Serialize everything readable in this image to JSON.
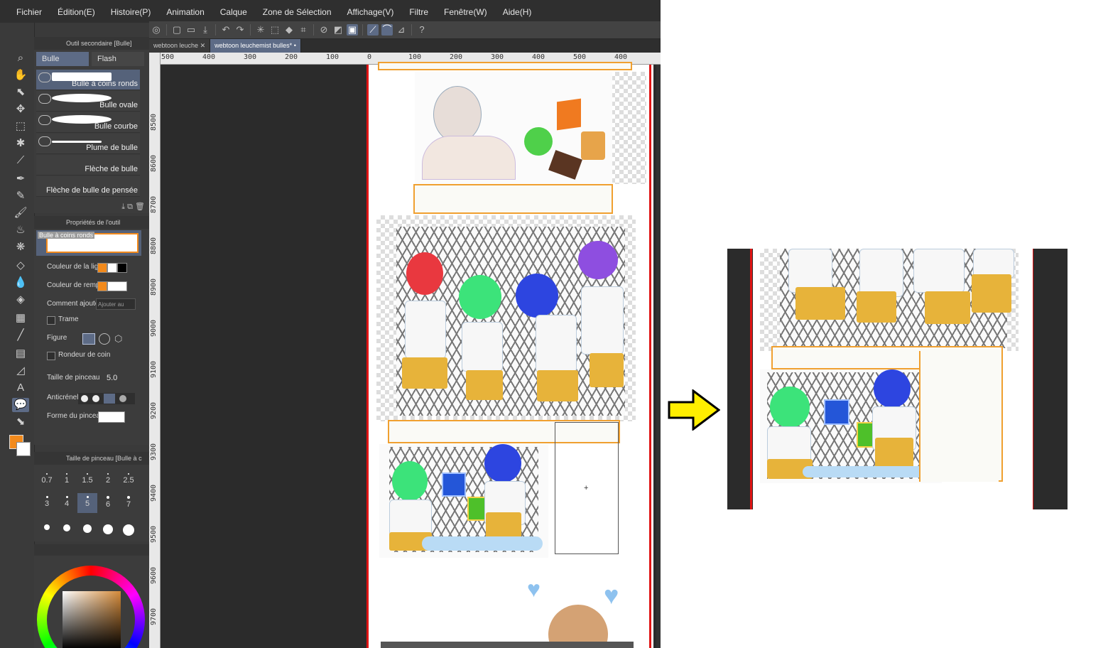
{
  "menu": [
    "Fichier",
    "Édition(E)",
    "Histoire(P)",
    "Animation",
    "Calque",
    "Zone de Sélection",
    "Affichage(V)",
    "Filtre",
    "Fenêtre(W)",
    "Aide(H)"
  ],
  "subtool": {
    "title": "Outil secondaire [Bulle]",
    "tabs": [
      "Bulle",
      "Flash"
    ],
    "items": [
      "Bulle à coins ronds",
      "Bulle ovale",
      "Bulle courbe",
      "Plume de bulle",
      "Flèche de bulle",
      "Flèche de bulle de pensée"
    ]
  },
  "tool_props": {
    "title": "Propriétés de l'outil",
    "preview_label": "Bulle à coins ronds",
    "line_color_label": "Couleur de la ligne",
    "fill_color_label": "Couleur de remplis",
    "add_mode_label": "Comment ajouter",
    "add_mode_value": "Ajouter au",
    "screentone_label": "Trame",
    "figure_label": "Figure",
    "corner_label": "Rondeur de coin",
    "brush_size_label": "Taille de pinceau",
    "brush_size_value": "5.0",
    "antialias_label": "Anticrénel.",
    "brush_shape_label": "Forme du pinceau"
  },
  "brush_size_panel": {
    "title": "Taille de pinceau [Bulle à c",
    "row1": [
      "0.7",
      "1",
      "1.5",
      "2",
      "2.5"
    ],
    "row2": [
      "3",
      "4",
      "5",
      "6",
      "7"
    ],
    "selected": "5"
  },
  "colors": {
    "main": "#f28a1c",
    "sub": "#ffffff",
    "accent": "#5d6b86",
    "red_guide": "#e01414",
    "frame": "#f0a030"
  },
  "doc_tabs": [
    "webtoon leuche",
    "webtoon leuchemist bulles*"
  ],
  "ruler_top": [
    "500",
    "400",
    "300",
    "200",
    "100",
    "0",
    "100",
    "200",
    "300",
    "400",
    "500",
    "400"
  ],
  "ruler_left": [
    "8500",
    "8600",
    "8700",
    "8800",
    "8900",
    "9000",
    "9100",
    "9200",
    "9300",
    "9400",
    "9500",
    "9600",
    "9700"
  ]
}
